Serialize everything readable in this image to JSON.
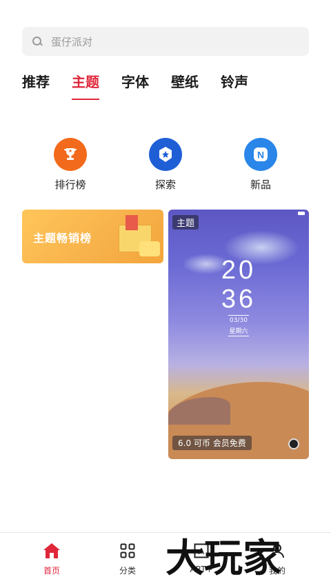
{
  "search": {
    "placeholder": "蛋仔派对"
  },
  "tabs": [
    {
      "label": "推荐",
      "active": false
    },
    {
      "label": "主题",
      "active": true
    },
    {
      "label": "字体",
      "active": false
    },
    {
      "label": "壁纸",
      "active": false
    },
    {
      "label": "铃声",
      "active": false
    }
  ],
  "quick_links": [
    {
      "label": "排行榜",
      "icon": "trophy-icon",
      "color": "#f26a1b"
    },
    {
      "label": "探索",
      "icon": "compass-icon",
      "color": "#1f5fd6"
    },
    {
      "label": "新品",
      "icon": "new-icon",
      "color": "#2a86e8"
    }
  ],
  "banner": {
    "text": "主题畅销榜"
  },
  "theme_card": {
    "tag": "主题",
    "clock_hour": "20",
    "clock_min": "36",
    "date": "03/30",
    "weekday": "星期六",
    "price": "6.0 可币   会员免费"
  },
  "bottom_nav": [
    {
      "label": "首页",
      "icon": "home-icon",
      "active": true
    },
    {
      "label": "分类",
      "icon": "grid-icon",
      "active": false
    },
    {
      "label": "ART+",
      "icon": "art-icon",
      "active": false
    },
    {
      "label": "我的",
      "icon": "profile-icon",
      "active": false
    }
  ],
  "watermark": "大玩家",
  "colors": {
    "accent": "#e0263a"
  }
}
